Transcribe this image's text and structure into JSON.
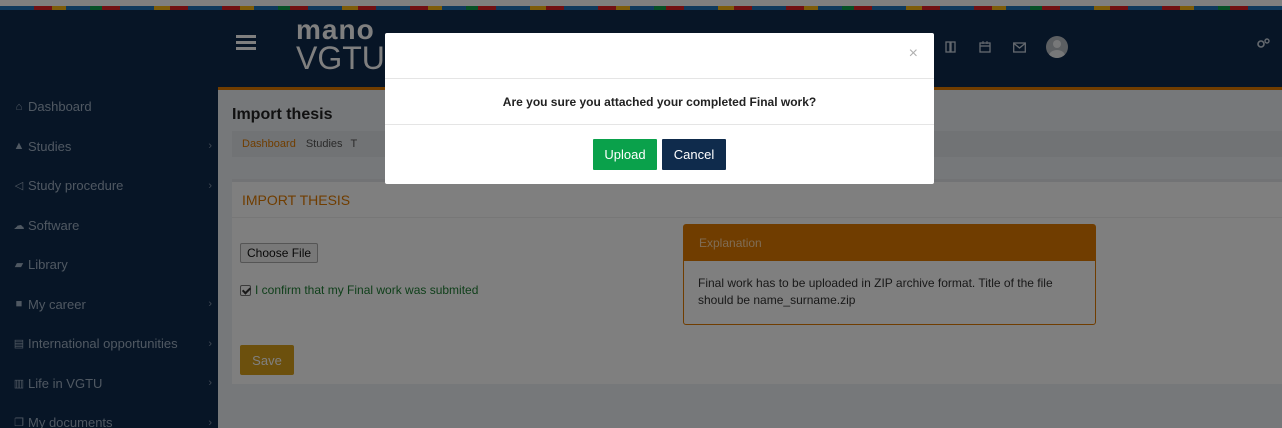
{
  "header": {
    "brand_line1": "mano",
    "brand_line2": "VGTU",
    "icons": [
      "book-icon",
      "calendar-icon",
      "envelope-icon",
      "avatar",
      "gears-icon"
    ]
  },
  "sidebar": {
    "items": [
      {
        "label": "Dashboard",
        "icon": "home-icon",
        "has_submenu": false
      },
      {
        "label": "Studies",
        "icon": "graduation-cap-icon",
        "has_submenu": true
      },
      {
        "label": "Study procedure",
        "icon": "bullhorn-icon",
        "has_submenu": true
      },
      {
        "label": "Software",
        "icon": "cloud-icon",
        "has_submenu": false
      },
      {
        "label": "Library",
        "icon": "book-icon",
        "has_submenu": false
      },
      {
        "label": "My career",
        "icon": "briefcase-icon",
        "has_submenu": true
      },
      {
        "label": "International opportunities",
        "icon": "id-card-icon",
        "has_submenu": true
      },
      {
        "label": "Life in VGTU",
        "icon": "institution-icon",
        "has_submenu": true
      },
      {
        "label": "My documents",
        "icon": "copy-icon",
        "has_submenu": true
      }
    ]
  },
  "page": {
    "title": "Import thesis",
    "breadcrumb": [
      "Dashboard",
      "Studies",
      "T"
    ]
  },
  "form": {
    "box_title": "IMPORT THESIS",
    "file_button": "Choose File",
    "confirm_label": "I confirm that my Final work was submited",
    "confirm_checked": true,
    "save_label": "Save"
  },
  "explanation": {
    "title": "Explanation",
    "text": "Final work has to be uploaded in ZIP archive format. Title of the file should be name_surname.zip"
  },
  "modal": {
    "close": "×",
    "message": "Are you sure you attached your completed Final work?",
    "upload_label": "Upload",
    "cancel_label": "Cancel"
  },
  "colors": {
    "navy": "#0f2b4c",
    "orange": "#e07b00",
    "green": "#0aa14b",
    "gold": "#d9a01b"
  }
}
